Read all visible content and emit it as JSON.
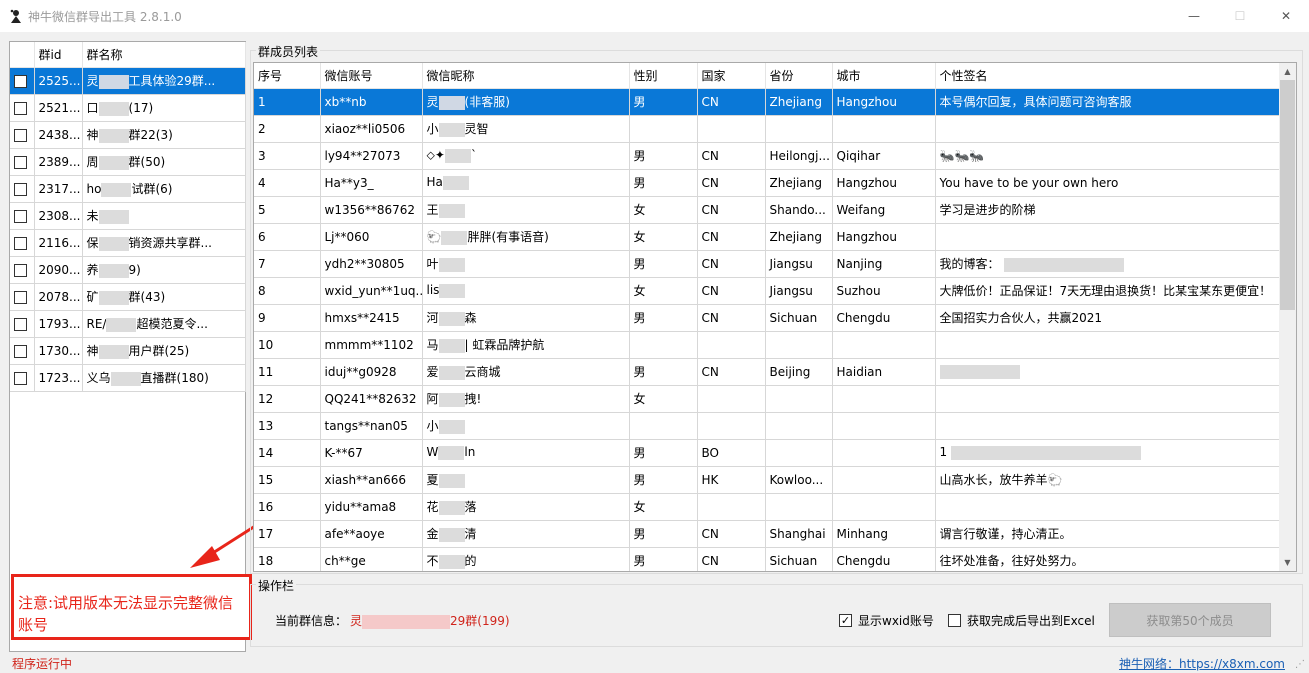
{
  "window": {
    "title": "神牛微信群导出工具 2.8.1.0",
    "minimize_glyph": "—",
    "maximize_glyph": "☐",
    "close_glyph": "✕"
  },
  "groups": {
    "headers": [
      "群id",
      "群名称"
    ],
    "rows": [
      {
        "id": "2525...",
        "pre": "灵",
        "post": "工具体验29群..."
      },
      {
        "id": "2521...",
        "pre": "口",
        "post": "(17)"
      },
      {
        "id": "2438...",
        "pre": "神",
        "post": "群22(3)"
      },
      {
        "id": "2389...",
        "pre": "周",
        "post": "群(50)"
      },
      {
        "id": "2317...",
        "pre": "ho",
        "post": "试群(6)"
      },
      {
        "id": "2308...",
        "pre": "未",
        "post": ""
      },
      {
        "id": "2116...",
        "pre": "保",
        "post": "销资源共享群..."
      },
      {
        "id": "2090...",
        "pre": "养",
        "post": "9)"
      },
      {
        "id": "2078...",
        "pre": "矿",
        "post": "群(43)"
      },
      {
        "id": "1793...",
        "pre": "RE/",
        "post": "超模范夏令..."
      },
      {
        "id": "1730...",
        "pre": "神",
        "post": "用户群(25)"
      },
      {
        "id": "1723...",
        "pre": "义乌",
        "post": "直播群(180)"
      }
    ]
  },
  "note": "注意:试用版本无法显示完整微信账号",
  "status_left": "程序运行中",
  "members": {
    "group_title": "群成员列表",
    "headers": [
      "序号",
      "微信账号",
      "微信昵称",
      "性别",
      "国家",
      "省份",
      "城市",
      "个性签名"
    ],
    "rows": [
      {
        "n": "1",
        "acct": "xb**nb",
        "nick_pre": "灵",
        "nick_post": "(非客服)",
        "sex": "男",
        "country": "CN",
        "prov": "Zhejiang",
        "city": "Hangzhou",
        "sig": "本号偶尔回复，具体问题可咨询客服"
      },
      {
        "n": "2",
        "acct": "xiaoz**li0506",
        "nick_pre": "小",
        "nick_post": "灵智",
        "sex": "",
        "country": "",
        "prov": "",
        "city": "",
        "sig": ""
      },
      {
        "n": "3",
        "acct": "ly94**27073",
        "nick_pre": "⬦✦",
        "nick_post": "`",
        "sex": "男",
        "country": "CN",
        "prov": "Heilongj...",
        "city": "Qiqihar",
        "sig": "🐜🐜🐜"
      },
      {
        "n": "4",
        "acct": "Ha**y3_",
        "nick_pre": "Ha",
        "nick_post": "",
        "sex": "男",
        "country": "CN",
        "prov": "Zhejiang",
        "city": "Hangzhou",
        "sig": "You have to be your own hero"
      },
      {
        "n": "5",
        "acct": "w1356**86762",
        "nick_pre": "王",
        "nick_post": "",
        "sex": "女",
        "country": "CN",
        "prov": "Shando...",
        "city": "Weifang",
        "sig": "学习是进步的阶梯"
      },
      {
        "n": "6",
        "acct": "Lj**060",
        "nick_pre": "🐑",
        "nick_post": "胖胖(有事语音)",
        "sex": "女",
        "country": "CN",
        "prov": "Zhejiang",
        "city": "Hangzhou",
        "sig": ""
      },
      {
        "n": "7",
        "acct": "ydh2**30805",
        "nick_pre": "叶",
        "nick_post": "",
        "sex": "男",
        "country": "CN",
        "prov": "Jiangsu",
        "city": "Nanjing",
        "sig": "我的博客："
      },
      {
        "n": "8",
        "acct": "wxid_yun**1uq...",
        "nick_pre": "lis",
        "nick_post": "",
        "sex": "女",
        "country": "CN",
        "prov": "Jiangsu",
        "city": "Suzhou",
        "sig": "大牌低价！正品保证！7天无理由退换货！比某宝某东更便宜！"
      },
      {
        "n": "9",
        "acct": "hmxs**2415",
        "nick_pre": "河",
        "nick_post": "森",
        "sex": "男",
        "country": "CN",
        "prov": "Sichuan",
        "city": "Chengdu",
        "sig": "全国招实力合伙人，共赢2021"
      },
      {
        "n": "10",
        "acct": "mmmm**1102",
        "nick_pre": "马",
        "nick_post": "| 虹霖品牌护航",
        "sex": "",
        "country": "",
        "prov": "",
        "city": "",
        "sig": ""
      },
      {
        "n": "11",
        "acct": "iduj**g0928",
        "nick_pre": "爱",
        "nick_post": "云商城",
        "sex": "男",
        "country": "CN",
        "prov": "Beijing",
        "city": "Haidian",
        "sig": ""
      },
      {
        "n": "12",
        "acct": "QQ241**82632",
        "nick_pre": "阿",
        "nick_post": "拽!",
        "sex": "女",
        "country": "",
        "prov": "",
        "city": "",
        "sig": ""
      },
      {
        "n": "13",
        "acct": "tangs**nan05",
        "nick_pre": "小",
        "nick_post": "",
        "sex": "",
        "country": "",
        "prov": "",
        "city": "",
        "sig": ""
      },
      {
        "n": "14",
        "acct": "K-**67",
        "nick_pre": "W",
        "nick_post": "ln",
        "sex": "男",
        "country": "BO",
        "prov": "",
        "city": "",
        "sig": "1"
      },
      {
        "n": "15",
        "acct": "xiash**an666",
        "nick_pre": "夏",
        "nick_post": "",
        "sex": "男",
        "country": "HK",
        "prov": "Kowloo...",
        "city": "",
        "sig": "山高水长，放牛养羊🐑"
      },
      {
        "n": "16",
        "acct": "yidu**ama8",
        "nick_pre": "花",
        "nick_post": "落",
        "sex": "女",
        "country": "",
        "prov": "",
        "city": "",
        "sig": ""
      },
      {
        "n": "17",
        "acct": "afe**aoye",
        "nick_pre": "金",
        "nick_post": "清",
        "sex": "男",
        "country": "CN",
        "prov": "Shanghai",
        "city": "Minhang",
        "sig": "谓言行敬谨，持心清正。"
      },
      {
        "n": "18",
        "acct": "ch**ge",
        "nick_pre": "不",
        "nick_post": "的",
        "sex": "男",
        "country": "CN",
        "prov": "Sichuan",
        "city": "Chengdu",
        "sig": "往坏处准备，往好处努力。"
      }
    ]
  },
  "ops": {
    "group_title": "操作栏",
    "current_label": "当前群信息：",
    "current_pre": "灵",
    "current_post": "29群(199)",
    "show_wxid_label": "显示wxid账号",
    "show_wxid_checked": "✓",
    "export_label": "获取完成后导出到Excel",
    "fetch_button": "获取第50个成员"
  },
  "status_right": "神牛网络：https://x8xm.com",
  "colors": {
    "selection": "#0a78d7",
    "accent_red": "#e8251a",
    "link": "#1a5fb4"
  }
}
